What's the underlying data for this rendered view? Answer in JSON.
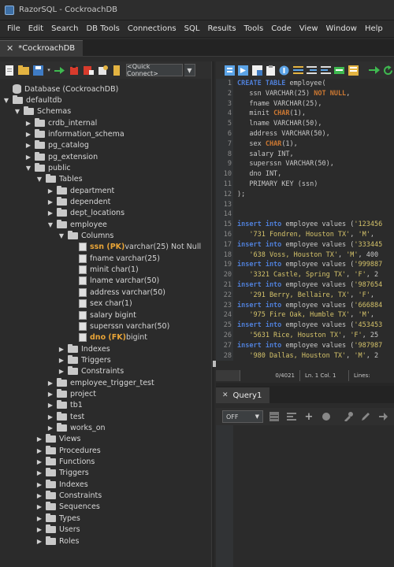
{
  "window": {
    "title": "RazorSQL - CockroachDB"
  },
  "menu": [
    "File",
    "Edit",
    "Search",
    "DB Tools",
    "Connections",
    "SQL",
    "Results",
    "Tools",
    "Code",
    "View",
    "Window",
    "Help"
  ],
  "main_tab": {
    "label": "*CockroachDB"
  },
  "left_toolbar": {
    "quick_connect_label": "<Quick Connect>"
  },
  "tree": {
    "rows": [
      {
        "level": 0,
        "toggle": "",
        "icon": "database-icon",
        "label": "Database (CockroachDB)"
      },
      {
        "level": 0,
        "toggle": "▼",
        "icon": "folder-icon",
        "label": "defaultdb"
      },
      {
        "level": 1,
        "toggle": "▼",
        "icon": "folder-icon",
        "label": "Schemas"
      },
      {
        "level": 2,
        "toggle": "▶",
        "icon": "folder-icon",
        "label": "crdb_internal"
      },
      {
        "level": 2,
        "toggle": "▶",
        "icon": "folder-icon",
        "label": "information_schema"
      },
      {
        "level": 2,
        "toggle": "▶",
        "icon": "folder-icon",
        "label": "pg_catalog"
      },
      {
        "level": 2,
        "toggle": "▶",
        "icon": "folder-icon",
        "label": "pg_extension"
      },
      {
        "level": 2,
        "toggle": "▼",
        "icon": "folder-icon",
        "label": "public"
      },
      {
        "level": 3,
        "toggle": "▼",
        "icon": "folder-icon",
        "label": "Tables"
      },
      {
        "level": 4,
        "toggle": "▶",
        "icon": "folder-icon",
        "label": "department"
      },
      {
        "level": 4,
        "toggle": "▶",
        "icon": "folder-icon",
        "label": "dependent"
      },
      {
        "level": 4,
        "toggle": "▶",
        "icon": "folder-icon",
        "label": "dept_locations"
      },
      {
        "level": 4,
        "toggle": "▼",
        "icon": "folder-icon",
        "label": "employee"
      },
      {
        "level": 5,
        "toggle": "▼",
        "icon": "folder-icon",
        "label": "Columns"
      },
      {
        "level": 6,
        "toggle": "",
        "icon": "column-icon",
        "label": "ssn (PK)",
        "suffix": " varchar(25) Not Null",
        "key": true
      },
      {
        "level": 6,
        "toggle": "",
        "icon": "column-icon",
        "label": "fname varchar(25)"
      },
      {
        "level": 6,
        "toggle": "",
        "icon": "column-icon",
        "label": "minit char(1)"
      },
      {
        "level": 6,
        "toggle": "",
        "icon": "column-icon",
        "label": "lname varchar(50)"
      },
      {
        "level": 6,
        "toggle": "",
        "icon": "column-icon",
        "label": "address varchar(50)"
      },
      {
        "level": 6,
        "toggle": "",
        "icon": "column-icon",
        "label": "sex char(1)"
      },
      {
        "level": 6,
        "toggle": "",
        "icon": "column-icon",
        "label": "salary bigint"
      },
      {
        "level": 6,
        "toggle": "",
        "icon": "column-icon",
        "label": "superssn varchar(50)"
      },
      {
        "level": 6,
        "toggle": "",
        "icon": "column-icon",
        "label": "dno (FK)",
        "suffix": " bigint",
        "key": true
      },
      {
        "level": 5,
        "toggle": "▶",
        "icon": "folder-icon",
        "label": "Indexes"
      },
      {
        "level": 5,
        "toggle": "▶",
        "icon": "folder-icon",
        "label": "Triggers"
      },
      {
        "level": 5,
        "toggle": "▶",
        "icon": "folder-icon",
        "label": "Constraints"
      },
      {
        "level": 4,
        "toggle": "▶",
        "icon": "folder-icon",
        "label": "employee_trigger_test"
      },
      {
        "level": 4,
        "toggle": "▶",
        "icon": "folder-icon",
        "label": "project"
      },
      {
        "level": 4,
        "toggle": "▶",
        "icon": "folder-icon",
        "label": "tb1"
      },
      {
        "level": 4,
        "toggle": "▶",
        "icon": "folder-icon",
        "label": "test"
      },
      {
        "level": 4,
        "toggle": "▶",
        "icon": "folder-icon",
        "label": "works_on"
      },
      {
        "level": 3,
        "toggle": "▶",
        "icon": "folder-icon",
        "label": "Views"
      },
      {
        "level": 3,
        "toggle": "▶",
        "icon": "folder-icon",
        "label": "Procedures"
      },
      {
        "level": 3,
        "toggle": "▶",
        "icon": "folder-icon",
        "label": "Functions"
      },
      {
        "level": 3,
        "toggle": "▶",
        "icon": "folder-icon",
        "label": "Triggers"
      },
      {
        "level": 3,
        "toggle": "▶",
        "icon": "folder-icon",
        "label": "Indexes"
      },
      {
        "level": 3,
        "toggle": "▶",
        "icon": "folder-icon",
        "label": "Constraints"
      },
      {
        "level": 3,
        "toggle": "▶",
        "icon": "folder-icon",
        "label": "Sequences"
      },
      {
        "level": 3,
        "toggle": "▶",
        "icon": "folder-icon",
        "label": "Types"
      },
      {
        "level": 3,
        "toggle": "▶",
        "icon": "folder-icon",
        "label": "Users"
      },
      {
        "level": 3,
        "toggle": "▶",
        "icon": "folder-icon",
        "label": "Roles"
      }
    ]
  },
  "editor": {
    "lines": [
      {
        "n": "1",
        "parts": [
          [
            "kw",
            "CREATE TABLE"
          ],
          [
            "plain",
            " employee("
          ]
        ]
      },
      {
        "n": "2",
        "parts": [
          [
            "plain",
            "   ssn VARCHAR(25) "
          ],
          [
            "kw2",
            "NOT NULL"
          ],
          [
            "plain",
            ","
          ]
        ]
      },
      {
        "n": "3",
        "parts": [
          [
            "plain",
            "   fname VARCHAR(25),"
          ]
        ]
      },
      {
        "n": "4",
        "parts": [
          [
            "plain",
            "   minit "
          ],
          [
            "kw2",
            "CHAR"
          ],
          [
            "plain",
            "(1),"
          ]
        ]
      },
      {
        "n": "5",
        "parts": [
          [
            "plain",
            "   lname VARCHAR(50),"
          ]
        ]
      },
      {
        "n": "6",
        "parts": [
          [
            "plain",
            "   address VARCHAR(50),"
          ]
        ]
      },
      {
        "n": "7",
        "parts": [
          [
            "plain",
            "   sex "
          ],
          [
            "kw2",
            "CHAR"
          ],
          [
            "plain",
            "(1),"
          ]
        ]
      },
      {
        "n": "8",
        "parts": [
          [
            "plain",
            "   salary INT,"
          ]
        ]
      },
      {
        "n": "9",
        "parts": [
          [
            "plain",
            "   superssn VARCHAR(50),"
          ]
        ]
      },
      {
        "n": "10",
        "parts": [
          [
            "plain",
            "   dno INT,"
          ]
        ]
      },
      {
        "n": "11",
        "parts": [
          [
            "plain",
            "   PRIMARY KEY (ssn)"
          ]
        ]
      },
      {
        "n": "12",
        "parts": [
          [
            "plain",
            ");"
          ]
        ]
      },
      {
        "n": "13",
        "parts": []
      },
      {
        "n": "14",
        "parts": []
      },
      {
        "n": "15",
        "parts": [
          [
            "kw",
            "insert into"
          ],
          [
            "plain",
            " employee values ("
          ],
          [
            "str",
            "'123456"
          ]
        ]
      },
      {
        "n": "16",
        "parts": [
          [
            "str",
            "   '731 Fondren, Houston TX'"
          ],
          [
            "plain",
            ", "
          ],
          [
            "str",
            "'M'"
          ],
          [
            "plain",
            ","
          ]
        ]
      },
      {
        "n": "17",
        "parts": [
          [
            "kw",
            "insert into"
          ],
          [
            "plain",
            " employee values ("
          ],
          [
            "str",
            "'333445"
          ]
        ]
      },
      {
        "n": "18",
        "parts": [
          [
            "str",
            "   '638 Voss, Houston TX'"
          ],
          [
            "plain",
            ", "
          ],
          [
            "str",
            "'M'"
          ],
          [
            "plain",
            ", 400"
          ]
        ]
      },
      {
        "n": "19",
        "parts": [
          [
            "kw",
            "insert into"
          ],
          [
            "plain",
            " employee values ("
          ],
          [
            "str",
            "'999887"
          ]
        ]
      },
      {
        "n": "20",
        "parts": [
          [
            "str",
            "   '3321 Castle, Spring TX'"
          ],
          [
            "plain",
            ", "
          ],
          [
            "str",
            "'F'"
          ],
          [
            "plain",
            ", 2"
          ]
        ]
      },
      {
        "n": "21",
        "parts": [
          [
            "kw",
            "insert into"
          ],
          [
            "plain",
            " employee values ("
          ],
          [
            "str",
            "'987654"
          ]
        ]
      },
      {
        "n": "22",
        "parts": [
          [
            "str",
            "   '291 Berry, Bellaire, TX'"
          ],
          [
            "plain",
            ", "
          ],
          [
            "str",
            "'F'"
          ],
          [
            "plain",
            ","
          ]
        ]
      },
      {
        "n": "23",
        "parts": [
          [
            "kw",
            "insert into"
          ],
          [
            "plain",
            " employee values ("
          ],
          [
            "str",
            "'666884"
          ]
        ]
      },
      {
        "n": "24",
        "parts": [
          [
            "str",
            "   '975 Fire Oak, Humble TX'"
          ],
          [
            "plain",
            ", "
          ],
          [
            "str",
            "'M'"
          ],
          [
            "plain",
            ","
          ]
        ]
      },
      {
        "n": "25",
        "parts": [
          [
            "kw",
            "insert into"
          ],
          [
            "plain",
            " employee values ("
          ],
          [
            "str",
            "'453453"
          ]
        ]
      },
      {
        "n": "26",
        "parts": [
          [
            "str",
            "   '5631 Rice, Houston TX'"
          ],
          [
            "plain",
            ", "
          ],
          [
            "str",
            "'F'"
          ],
          [
            "plain",
            ", 25"
          ]
        ]
      },
      {
        "n": "27",
        "parts": [
          [
            "kw",
            "insert into"
          ],
          [
            "plain",
            " employee values ("
          ],
          [
            "str",
            "'987987"
          ]
        ]
      },
      {
        "n": "28",
        "parts": [
          [
            "str",
            "   '980 Dallas, Houston TX'"
          ],
          [
            "plain",
            ", "
          ],
          [
            "str",
            "'M'"
          ],
          [
            "plain",
            ", 2"
          ]
        ]
      },
      {
        "n": "29",
        "parts": []
      }
    ]
  },
  "status": {
    "position": "0/4021",
    "cursor": "Ln. 1 Col. 1",
    "lines": "Lines:"
  },
  "query_tab": {
    "label": "Query1"
  },
  "query_toolbar": {
    "autocommit": "OFF"
  },
  "colors": {
    "keyword": "#4f7fd8",
    "keyword_alt": "#cc7832",
    "string": "#d4c26a",
    "pk_fk": "#e8a437"
  }
}
